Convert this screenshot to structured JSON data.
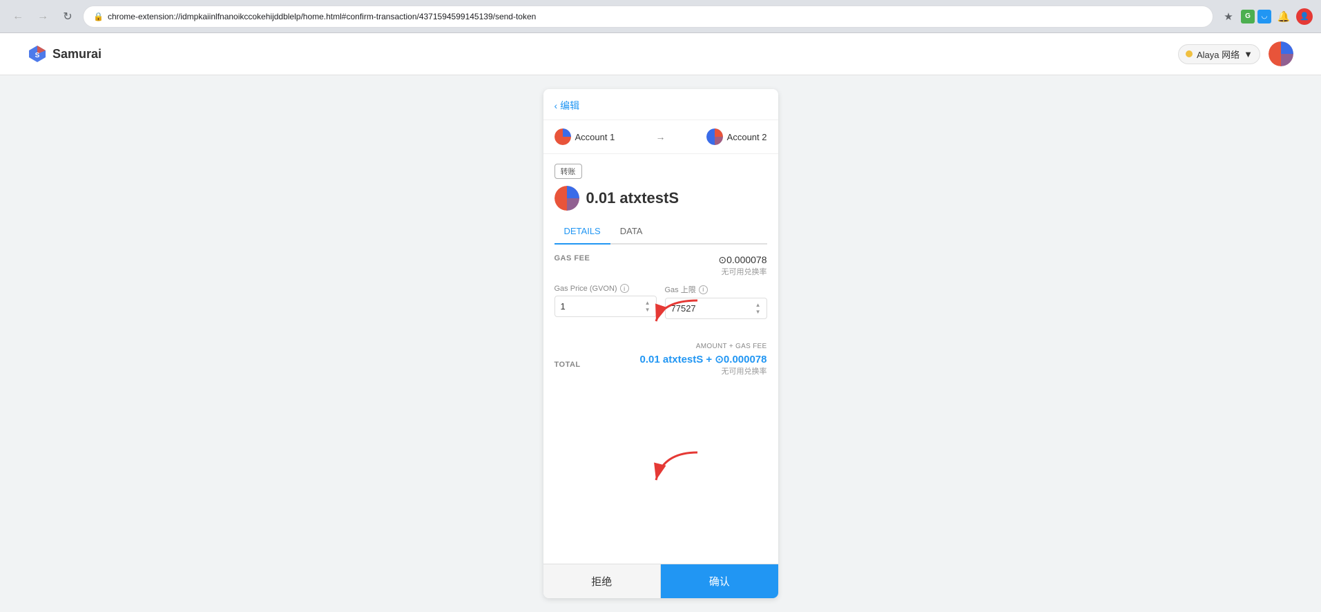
{
  "browser": {
    "url": "chrome-extension://idmpkaiinlfnanoikccokehijddblelp/home.html#confirm-transaction/4371594599145139/send-token",
    "title": "Samurai"
  },
  "header": {
    "logo_text": "Samurai",
    "network_label": "Alaya 网络",
    "network_chevron": "▾"
  },
  "back_label": "编辑",
  "accounts": {
    "from_label": "Account 1",
    "to_label": "Account 2"
  },
  "transfer_badge": "转账",
  "amount": "0.01 atxtestS",
  "tabs": [
    {
      "label": "DETAILS",
      "active": true
    },
    {
      "label": "DATA",
      "active": false
    }
  ],
  "gas_fee": {
    "label": "GAS FEE",
    "value": "⊙0.000078",
    "sub": "无可用兑换率"
  },
  "gas_price": {
    "label": "Gas Price (GVON)",
    "value": "1"
  },
  "gas_limit": {
    "label": "Gas 上限",
    "value": "77527"
  },
  "total": {
    "amount_gas_label": "AMOUNT + GAS FEE",
    "label": "TOTAL",
    "value": "0.01 atxtestS + ⊙0.000078",
    "sub": "无可用兑换率"
  },
  "buttons": {
    "reject_label": "拒绝",
    "confirm_label": "确认"
  },
  "colors": {
    "accent": "#2196f3",
    "pie1": "#e8543a",
    "pie2": "#3a6ce8"
  }
}
